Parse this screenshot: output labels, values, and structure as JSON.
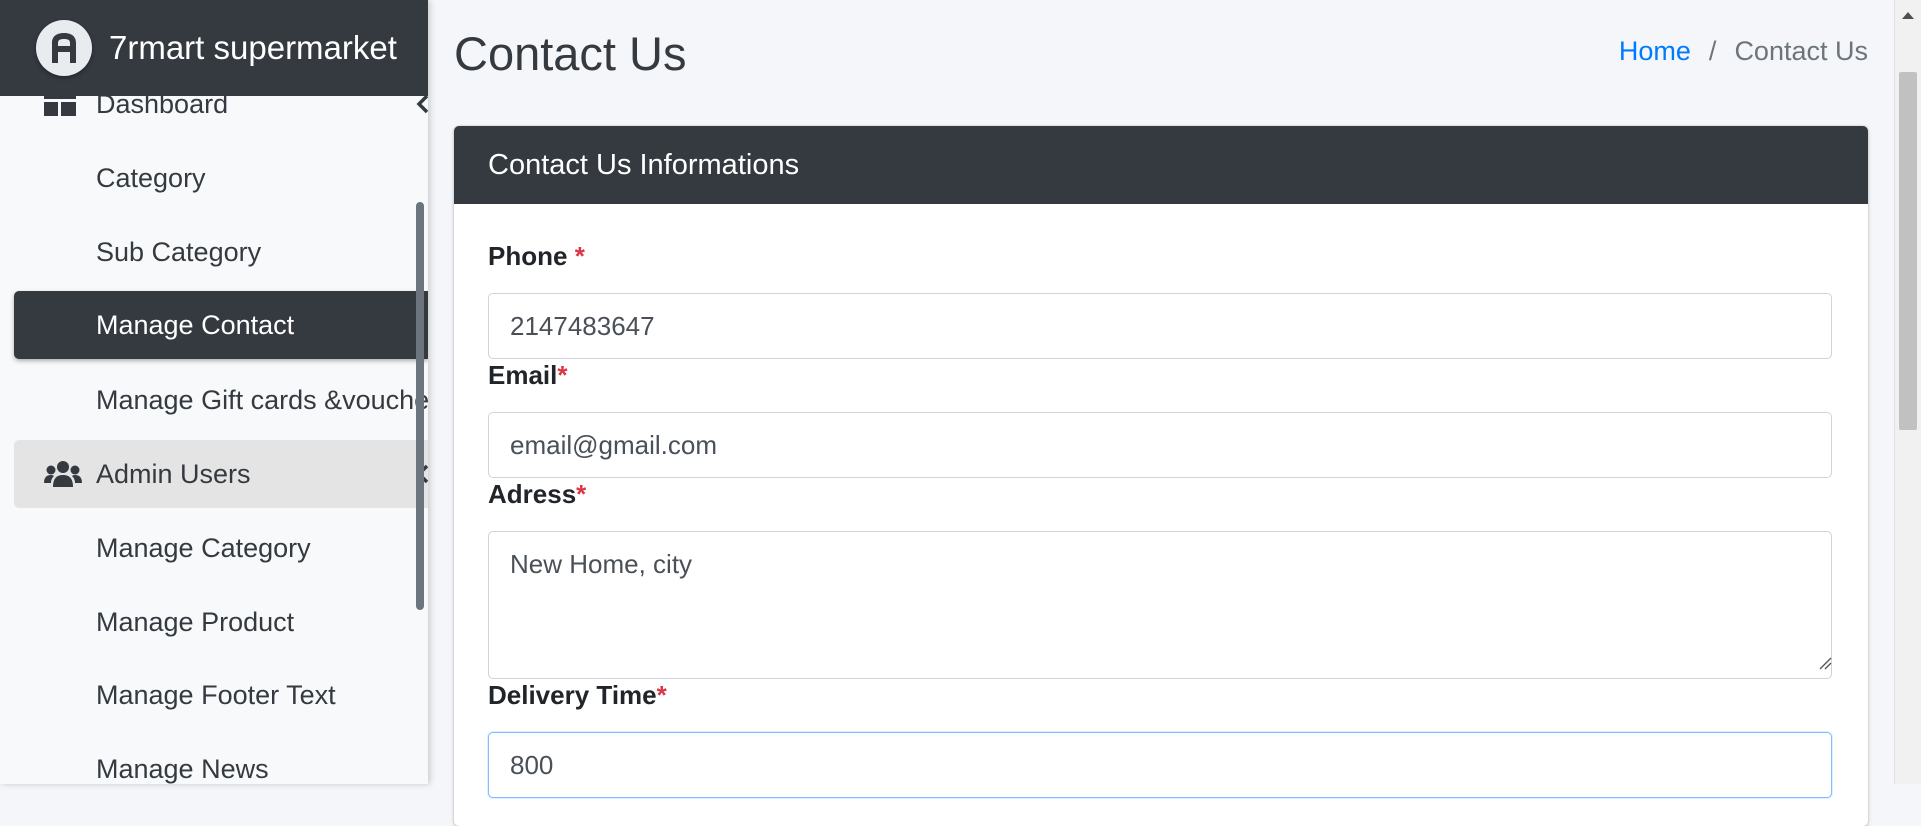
{
  "brand": {
    "name": "7rmart supermarket"
  },
  "sidebar": {
    "items": [
      {
        "label": "Dashboard",
        "icon": "dashboard-icon"
      },
      {
        "label": "Category"
      },
      {
        "label": "Sub Category"
      },
      {
        "label": "Manage Contact",
        "active": true
      },
      {
        "label": "Manage Gift cards &vouchers"
      },
      {
        "label": "Admin Users",
        "icon": "users-icon",
        "open": true
      },
      {
        "label": "Manage Category"
      },
      {
        "label": "Manage Product"
      },
      {
        "label": "Manage Footer Text"
      },
      {
        "label": "Manage News"
      }
    ]
  },
  "header": {
    "title": "Contact Us",
    "breadcrumb": {
      "home": "Home",
      "separator": "/",
      "current": "Contact Us"
    }
  },
  "card": {
    "title": "Contact Us Informations",
    "fields": {
      "phone": {
        "label": "Phone",
        "required_mark": "*",
        "value": "2147483647"
      },
      "email": {
        "label": "Email",
        "required_mark": "*",
        "value": "email@gmail.com"
      },
      "address": {
        "label": "Adress",
        "required_mark": "*",
        "value": "New Home, city"
      },
      "delivery_time": {
        "label": "Delivery Time",
        "required_mark": "*",
        "value": "800"
      }
    }
  },
  "colors": {
    "dark": "#343a40",
    "link": "#007bff",
    "required": "#dc3545",
    "background": "#f4f6f9"
  }
}
